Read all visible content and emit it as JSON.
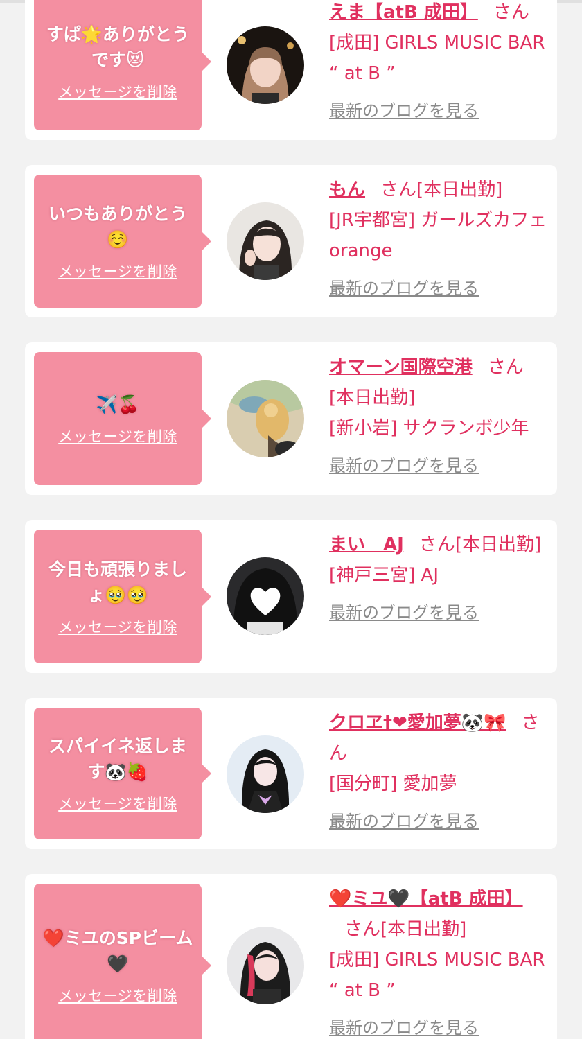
{
  "messages": [
    {
      "text": "すぱ🌟ありがとうです😻",
      "delete_label": "メッセージを削除",
      "name": "えま【atB 成田】",
      "san": "さん",
      "status": "",
      "shop": "[成田] GIRLS MUSIC BAR “ at B ”",
      "blog_label": "最新のブログを見る"
    },
    {
      "text": "いつもありがとう☺️",
      "delete_label": "メッセージを削除",
      "name": "もん",
      "san": "さん",
      "status": "[本日出勤]",
      "shop": "[JR宇都宮] ガールズカフェ orange",
      "blog_label": "最新のブログを見る"
    },
    {
      "text": "✈️🍒",
      "delete_label": "メッセージを削除",
      "name": "オマーン国際空港",
      "san": "さん",
      "status": "[本日出勤]",
      "shop": "[新小岩] サクランボ少年",
      "blog_label": "最新のブログを見る"
    },
    {
      "text": "今日も頑張りましょ🥹🥹",
      "delete_label": "メッセージを削除",
      "name": "まい　AJ",
      "san": "さん",
      "status": "[本日出勤]",
      "shop": "[神戸三宮] AJ",
      "blog_label": "最新のブログを見る"
    },
    {
      "text": "スパイイネ返します🐼🍓",
      "delete_label": "メッセージを削除",
      "name": "クロヱ†❤愛加夢🐼🎀",
      "san": "さん",
      "status": "",
      "shop": "[国分町] 愛加夢",
      "blog_label": "最新のブログを見る"
    },
    {
      "text": "❤️ミユのSPビーム🖤",
      "delete_label": "メッセージを削除",
      "name": "❤️ミユ🖤【atB 成田】",
      "san": "さん",
      "status": "[本日出勤]",
      "shop": "[成田] GIRLS MUSIC BAR “ at B ”",
      "blog_label": "最新のブログを見る"
    }
  ]
}
